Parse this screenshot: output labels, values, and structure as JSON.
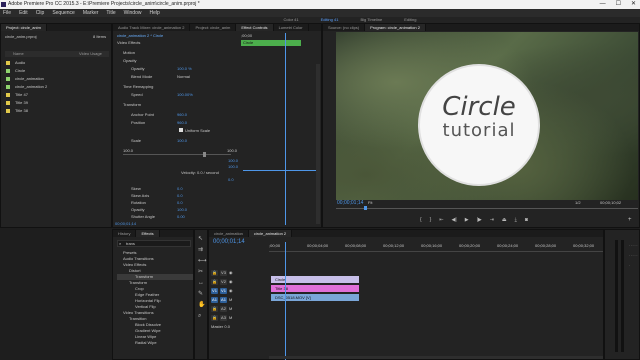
{
  "titlebar": {
    "title": "Adobe Premiere Pro CC 2015.3 - E:\\Premiere Projects\\circle_anim\\circle_anim.prproj *",
    "minimize": "—",
    "maximize": "☐",
    "close": "✕"
  },
  "menu": [
    "File",
    "Edit",
    "Clip",
    "Sequence",
    "Marker",
    "Title",
    "Window",
    "Help"
  ],
  "workspaces": {
    "items": [
      "Color 41",
      "Editing 41",
      "Big Timeline",
      "Editing"
    ],
    "active_index": 1
  },
  "project_panel": {
    "tab": "Project: circle_anim",
    "file": "circle_anim.prproj",
    "count": "8 Items",
    "col_name": "Name",
    "col_usage": "Video Usage",
    "items": [
      {
        "name": "Audio",
        "color": "#e0c94a"
      },
      {
        "name": "Circle",
        "color": "#8fd26e"
      },
      {
        "name": "circle_animation",
        "color": "#8fd26e"
      },
      {
        "name": "circle_animation 2",
        "color": "#8fd26e"
      },
      {
        "name": "Title 47",
        "color": "#e0c94a"
      },
      {
        "name": "Title 39",
        "color": "#e0c94a"
      },
      {
        "name": "Title 38",
        "color": "#e0c94a"
      }
    ]
  },
  "effect_controls": {
    "tabs": [
      "Audio Track Mixer: circle_animation 2",
      "Project: circle_anim",
      "Effect Controls",
      "Lumetri Color"
    ],
    "active_tab": 2,
    "header": "circle_animation 2 * Circle",
    "section": "Video Effects",
    "timecode_label": ";00;00",
    "clip_label": "Circle",
    "rows": [
      {
        "name": "Motion",
        "value": ""
      },
      {
        "name": "Opacity",
        "value": ""
      },
      {
        "name": "Opacity",
        "value": "100.0 %"
      },
      {
        "name": "Blend Mode",
        "value": "Normal"
      },
      {
        "name": "Time Remapping",
        "value": ""
      },
      {
        "name": "Speed",
        "value": "100.00%"
      },
      {
        "name": "Transform",
        "value": ""
      },
      {
        "name": "Anchor Point",
        "value": "960.0"
      },
      {
        "name": "Position",
        "value": "960.0"
      },
      {
        "name": "Uniform Scale",
        "value": ""
      },
      {
        "name": "Scale",
        "value": "100.0"
      }
    ],
    "scale_min": "100.0",
    "scale_max": "100.0",
    "graph_vals": [
      "100.0",
      "100.0",
      "100.0"
    ],
    "velocity": "Velocity: 0.0 / second",
    "velocity_val": "0.0",
    "lower_rows": [
      {
        "name": "Skew",
        "value": "0.0"
      },
      {
        "name": "Skew Axis",
        "value": "0.0"
      },
      {
        "name": "Rotation",
        "value": "0.0"
      },
      {
        "name": "Opacity",
        "value": "100.0"
      },
      {
        "name": "Shutter Angle",
        "value": "0.00"
      }
    ],
    "footer_timecode": "00;00;01;14"
  },
  "program_monitor": {
    "tabs": [
      "Source: (no clips)",
      "Program: circle_animation 2"
    ],
    "title_big": "Circle",
    "title_small": "tutorial",
    "timecode": "00;00;01;14",
    "fit": "Fit",
    "quality": "1/2",
    "duration": "00;00;10;02"
  },
  "effects_panel": {
    "tabs": [
      "History",
      "Effects"
    ],
    "active_tab": 1,
    "search": "trans",
    "items": [
      {
        "label": "Presets",
        "indent": 0
      },
      {
        "label": "Audio Transitions",
        "indent": 0
      },
      {
        "label": "Video Effects",
        "indent": 0
      },
      {
        "label": "Distort",
        "indent": 1
      },
      {
        "label": "Transform",
        "indent": 2
      },
      {
        "label": "Transform",
        "indent": 1
      },
      {
        "label": "Crop",
        "indent": 2
      },
      {
        "label": "Edge Feather",
        "indent": 2
      },
      {
        "label": "Horizontal Flip",
        "indent": 2
      },
      {
        "label": "Vertical Flip",
        "indent": 2
      },
      {
        "label": "Video Transitions",
        "indent": 0
      },
      {
        "label": "Transition",
        "indent": 1
      },
      {
        "label": "Block Dissolve",
        "indent": 2
      },
      {
        "label": "Gradient Wipe",
        "indent": 2
      },
      {
        "label": "Linear Wipe",
        "indent": 2
      },
      {
        "label": "Radial Wipe",
        "indent": 2
      }
    ]
  },
  "timeline": {
    "tabs": [
      "circle_animation",
      "circle_animation 2"
    ],
    "active_tab": 1,
    "timecode": "00;00;01;14",
    "ruler": [
      ";00;00",
      "00;00;04;00",
      "00;00;08;00",
      "00;00;12;00",
      "00;00;16;00",
      "00;00;20;00",
      "00;00;24;00",
      "00;00;28;00",
      "00;00;32;00"
    ],
    "tracks": [
      "V3",
      "V2",
      "V1",
      "A1",
      "A2",
      "A3"
    ],
    "master": "Master",
    "master_val": "0.0",
    "clips": [
      {
        "label": "Circle",
        "color": "#c7bfe9",
        "track": 0
      },
      {
        "label": "Title 38",
        "color": "#e06fd8",
        "track": 1
      },
      {
        "label": "DSC_0518.MOV [V]",
        "color": "#7aa6d8",
        "track": 2
      }
    ]
  }
}
